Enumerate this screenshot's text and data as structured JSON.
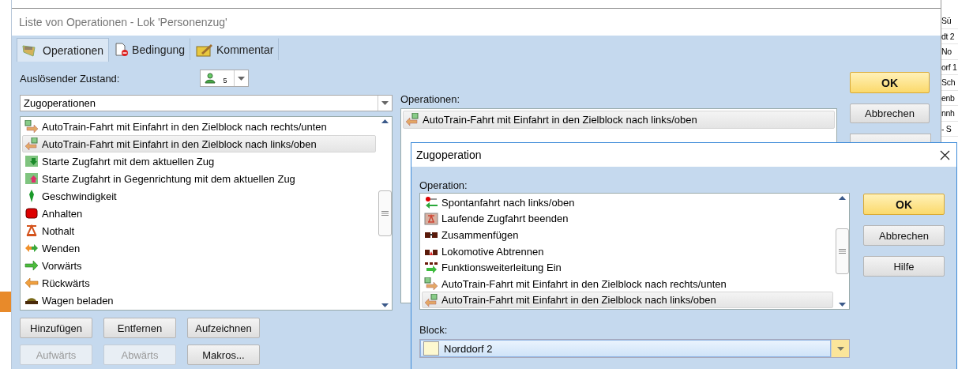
{
  "window": {
    "title": "Liste von Operationen - Lok 'Personenzug'"
  },
  "tabs": [
    {
      "label": "Operationen",
      "kind": "operations",
      "selected": true
    },
    {
      "label": "Bedingung",
      "kind": "condition",
      "selected": false
    },
    {
      "label": "Kommentar",
      "kind": "comment",
      "selected": false
    }
  ],
  "trigger": {
    "label": "Auslösender Zustand:",
    "badge": "5"
  },
  "category": {
    "value": "Zugoperationen"
  },
  "available": [
    {
      "label": "AutoTrain-Fahrt mit Einfahrt in den Zielblock nach rechts/unten",
      "kind": "autotrain-right",
      "selected": false
    },
    {
      "label": "AutoTrain-Fahrt mit Einfahrt in den Zielblock nach links/oben",
      "kind": "autotrain-left",
      "selected": true
    },
    {
      "label": "Starte Zugfahrt mit dem aktuellen Zug",
      "kind": "start",
      "selected": false
    },
    {
      "label": "Starte Zugfahrt in Gegenrichtung mit dem aktuellen Zug",
      "kind": "start-reverse",
      "selected": false
    },
    {
      "label": "Geschwindigkeit",
      "kind": "speed",
      "selected": false
    },
    {
      "label": "Anhalten",
      "kind": "stop",
      "selected": false
    },
    {
      "label": "Nothalt",
      "kind": "emergency",
      "selected": false
    },
    {
      "label": "Wenden",
      "kind": "turn",
      "selected": false
    },
    {
      "label": "Vorwärts",
      "kind": "forward",
      "selected": false
    },
    {
      "label": "Rückwärts",
      "kind": "backward",
      "selected": false
    },
    {
      "label": "Wagen beladen",
      "kind": "load",
      "selected": false
    }
  ],
  "list_buttons": [
    {
      "label": "Hinzufügen",
      "disabled": false
    },
    {
      "label": "Entfernen",
      "disabled": false
    },
    {
      "label": "Aufzeichnen",
      "disabled": false
    },
    {
      "label": "Aufwärts",
      "disabled": true
    },
    {
      "label": "Abwärts",
      "disabled": true
    },
    {
      "label": "Makros...",
      "disabled": false
    }
  ],
  "operations": {
    "label": "Operationen:",
    "items": [
      {
        "label": "AutoTrain-Fahrt mit Einfahrt in den Zielblock nach links/oben",
        "kind": "autotrain-left",
        "selected": true
      }
    ]
  },
  "side_buttons": [
    {
      "label": "OK",
      "kind": "default"
    },
    {
      "label": "Abbrechen",
      "kind": "normal"
    }
  ],
  "dialog": {
    "title": "Zugoperation",
    "operation_label": "Operation:",
    "items": [
      {
        "label": "Spontanfahrt nach links/oben",
        "kind": "spontan",
        "selected": false
      },
      {
        "label": "Laufende Zugfahrt beenden",
        "kind": "end-run",
        "selected": false
      },
      {
        "label": "Zusammenfügen",
        "kind": "couple",
        "selected": false
      },
      {
        "label": "Lokomotive Abtrennen",
        "kind": "detach",
        "selected": false
      },
      {
        "label": "Funktionsweiterleitung Ein",
        "kind": "function",
        "selected": false
      },
      {
        "label": "AutoTrain-Fahrt mit Einfahrt in den Zielblock nach rechts/unten",
        "kind": "autotrain-right",
        "selected": false
      },
      {
        "label": "AutoTrain-Fahrt mit Einfahrt in den Zielblock nach links/oben",
        "kind": "autotrain-left",
        "selected": true
      }
    ],
    "block_label": "Block:",
    "block": {
      "value": "Norddorf 2"
    },
    "buttons": [
      {
        "label": "OK",
        "kind": "default"
      },
      {
        "label": "Abbrechen",
        "kind": "normal"
      },
      {
        "label": "Hilfe",
        "kind": "normal"
      }
    ]
  },
  "background_rows": [
    "Sü",
    "dt 2",
    "No",
    "orf 1",
    "Sch",
    "enb",
    "nnh",
    "- S"
  ]
}
